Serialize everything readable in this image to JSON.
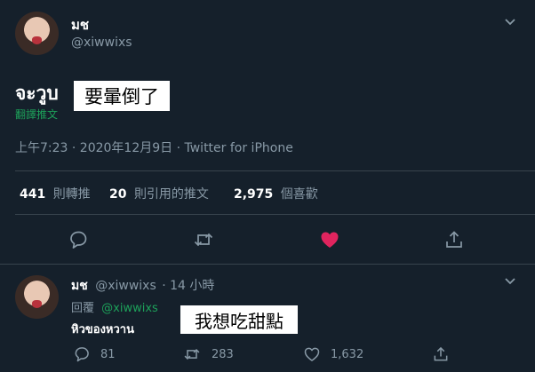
{
  "main_tweet": {
    "display_name": "มช",
    "handle": "@xiwwixs",
    "text": "จะวูบ",
    "translate_label": "翻譯推文",
    "overlay_text": "要暈倒了",
    "timestamp": "上午7:23 · 2020年12月9日 · Twitter for iPhone",
    "stats": {
      "retweets_count": "441",
      "retweets_label": "則轉推",
      "quotes_count": "20",
      "quotes_label": "則引用的推文",
      "likes_count": "2,975",
      "likes_label": "個喜歡"
    }
  },
  "reply_tweet": {
    "display_name": "มช",
    "handle": "@xiwwixs",
    "age": "· 14 小時",
    "replying_label": "回覆",
    "replying_to": "@xiwwixs",
    "text": "หิวของหวาน",
    "overlay_text": "我想吃甜點",
    "reply_count": "81",
    "retweet_count": "283",
    "like_count": "1,632"
  },
  "colors": {
    "background": "#15202b",
    "muted": "#8899a6",
    "like_active": "#e0245e",
    "link_green": "#1da15a",
    "divider": "#38444d"
  }
}
